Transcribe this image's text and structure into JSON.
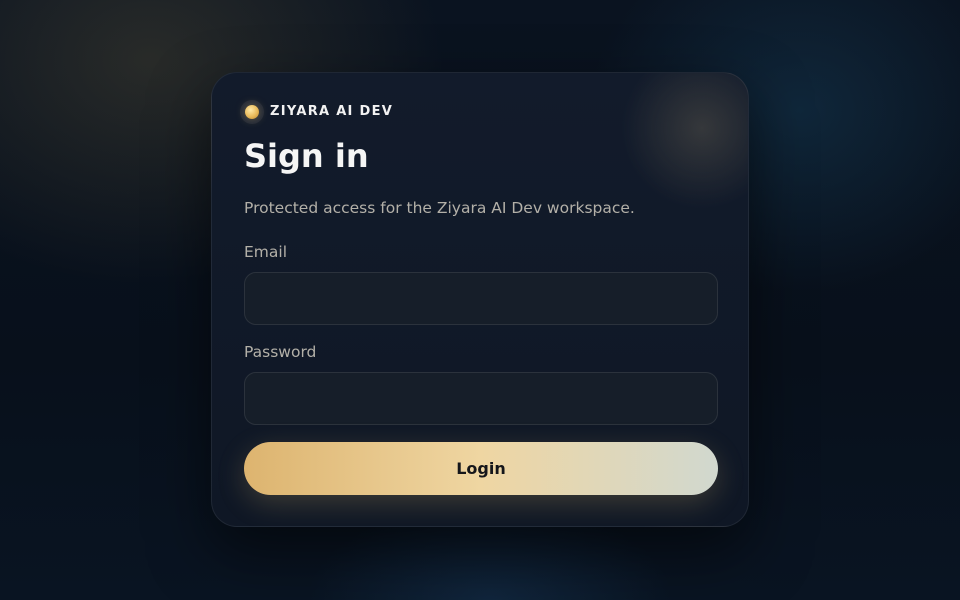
{
  "brand": {
    "name": "ZIYARA AI DEV",
    "icon": "brand-dot-icon"
  },
  "form": {
    "title": "Sign in",
    "subtitle": "Protected access for the Ziyara AI Dev workspace.",
    "email": {
      "label": "Email",
      "value": "",
      "placeholder": ""
    },
    "password": {
      "label": "Password",
      "value": "",
      "placeholder": ""
    },
    "submit_label": "Login"
  },
  "colors": {
    "accent_gradient_start": "#ddb46f",
    "accent_gradient_mid": "#efd6a2",
    "accent_gradient_end": "#d1d8cf",
    "card_background": "#121b2b",
    "page_background": "#0a1320"
  }
}
